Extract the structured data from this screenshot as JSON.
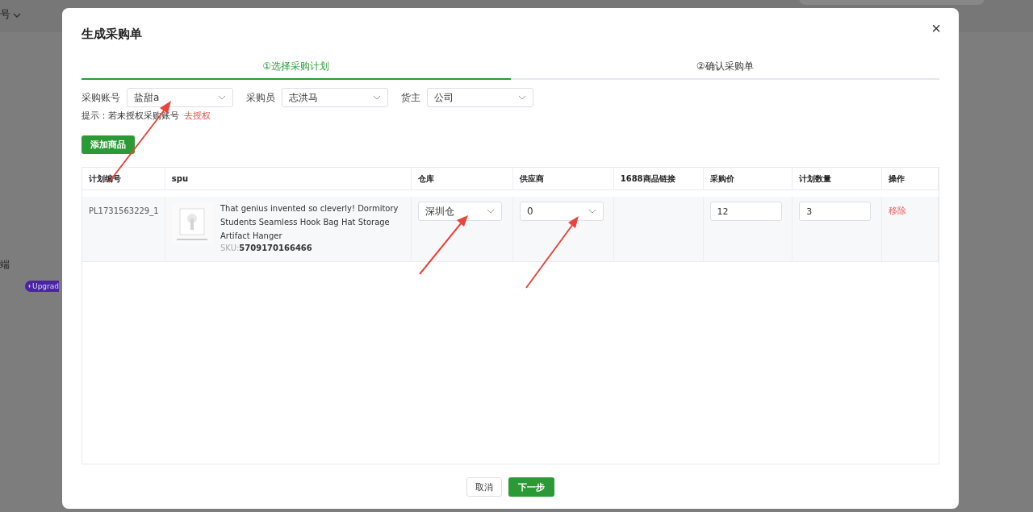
{
  "background": {
    "top_menu": "号",
    "sidebar_item": "端",
    "badge": "Upgrad"
  },
  "dialog": {
    "title": "生成采购单",
    "close": "×"
  },
  "steps": [
    {
      "label": "①选择采购计划",
      "selected": true
    },
    {
      "label": "②确认采购单",
      "selected": false
    }
  ],
  "filters": [
    {
      "label": "采购账号",
      "value": "盐甜a"
    },
    {
      "label": "采购员",
      "value": "志洪马"
    },
    {
      "label": "货主",
      "value": "公司"
    }
  ],
  "hint": {
    "text": "提示：若未授权采购账号",
    "link": "去授权"
  },
  "add_button": "添加商品",
  "table": {
    "columns": [
      "计划编号",
      "spu",
      "仓库",
      "供应商",
      "1688商品链接",
      "采购价",
      "计划数量",
      "操作"
    ],
    "rows": [
      {
        "plan_no": "PL1731563229_1",
        "title": "That genius invented so cleverly! Dormitory Students Seamless Hook Bag Hat Storage Artifact Hanger",
        "sku_label": "SKU:",
        "sku": "5709170166466",
        "warehouse": "深圳仓",
        "supplier": "0",
        "price": "12",
        "quantity": "3",
        "action": "移除"
      }
    ]
  },
  "buttons": {
    "cancel": "取消",
    "next": "下一步"
  }
}
